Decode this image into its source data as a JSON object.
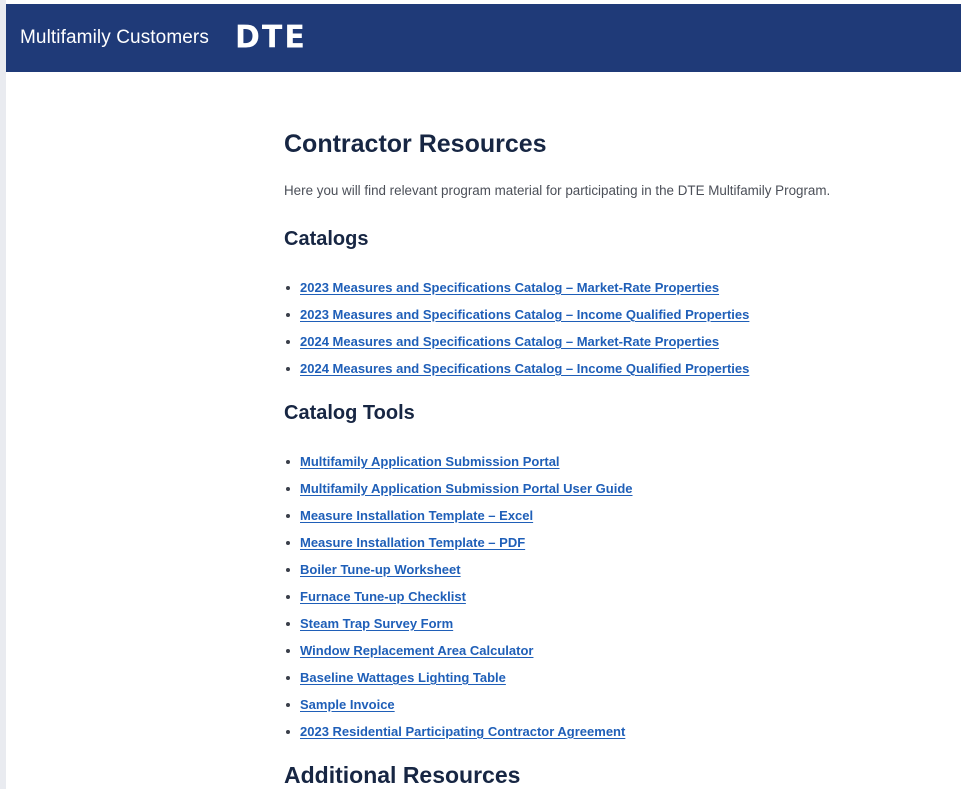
{
  "header": {
    "site_title": "Multifamily Customers",
    "logo_text": "DTE"
  },
  "main": {
    "title": "Contractor Resources",
    "intro": "Here you will find relevant program material for participating in the DTE Multifamily Program.",
    "catalogs": {
      "heading": "Catalogs",
      "links": [
        "2023 Measures and Specifications Catalog – Market-Rate Properties",
        "2023 Measures and Specifications Catalog – Income Qualified Properties",
        "2024 Measures and Specifications Catalog – Market-Rate Properties",
        "2024 Measures and Specifications Catalog – Income Qualified Properties"
      ]
    },
    "catalog_tools": {
      "heading": "Catalog Tools",
      "links": [
        "Multifamily Application Submission Portal",
        "Multifamily Application Submission Portal User Guide",
        "Measure Installation Template – Excel",
        "Measure Installation Template – PDF",
        "Boiler Tune-up Worksheet",
        "Furnace Tune-up Checklist",
        "Steam Trap Survey Form",
        "Window Replacement Area Calculator",
        "Baseline Wattages Lighting Table",
        "Sample Invoice",
        "2023 Residential Participating Contractor Agreement"
      ]
    },
    "additional": {
      "heading": "Additional Resources"
    }
  },
  "colors": {
    "header_bg": "#1f3a78",
    "link": "#1f5fb8",
    "heading": "#172643",
    "body_text": "#4b4f58"
  }
}
